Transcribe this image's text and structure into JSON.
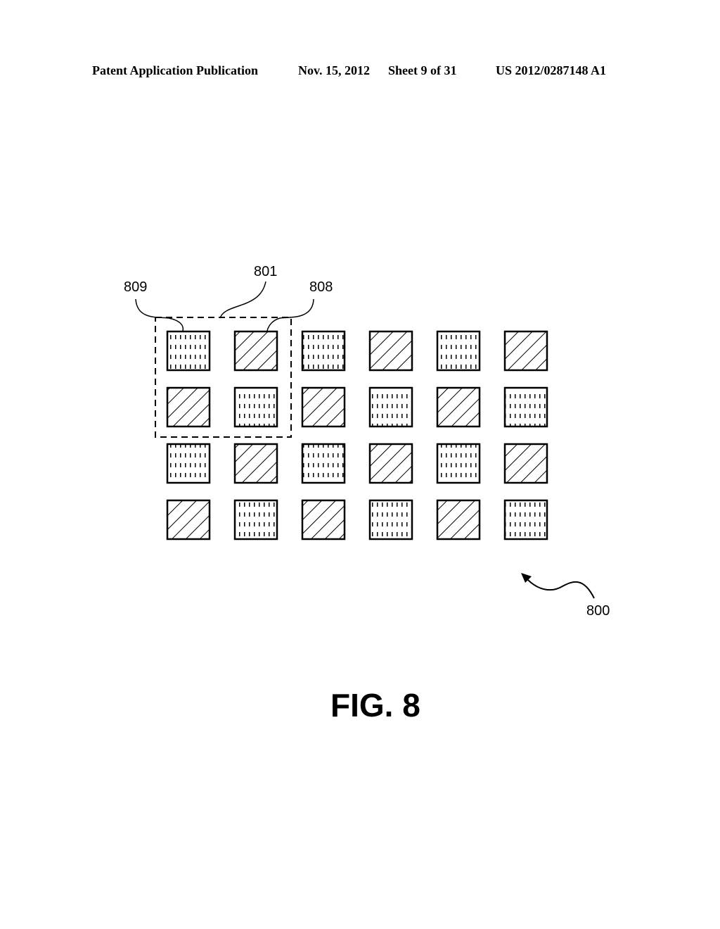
{
  "header": {
    "left": "Patent Application Publication",
    "date": "Nov. 15, 2012",
    "sheet": "Sheet 9 of 31",
    "number": "US 2012/0287148 A1"
  },
  "figure": {
    "caption": "FIG. 8",
    "grid": {
      "rows": 4,
      "cols": 6,
      "pattern": "checkerboard",
      "cell_types": [
        "dotted",
        "hatched"
      ],
      "first_cell": "dotted"
    },
    "labels": {
      "group": "801",
      "dotted_element": "809",
      "hatched_element": "808",
      "array": "800"
    }
  }
}
